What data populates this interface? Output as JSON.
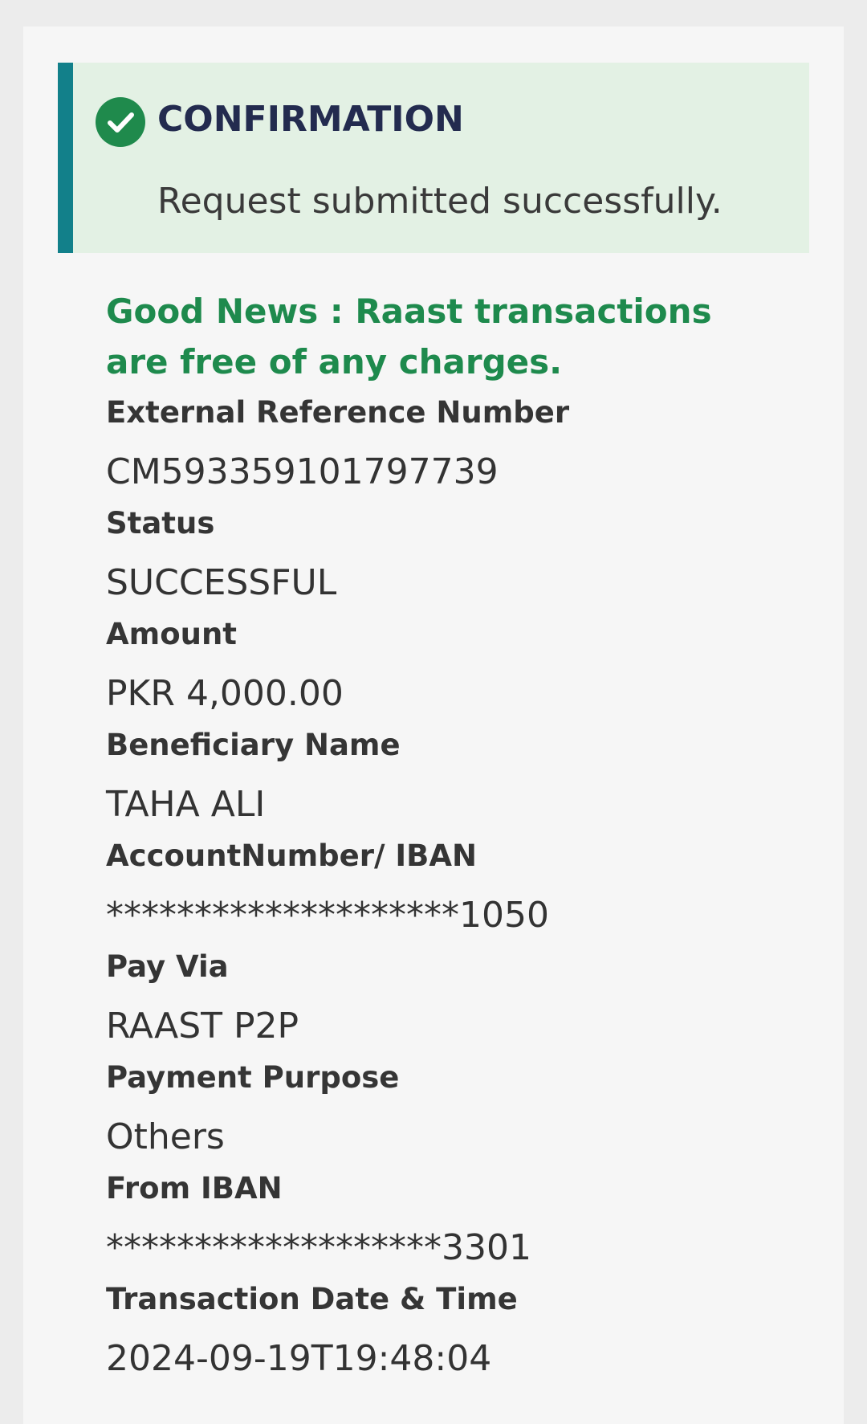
{
  "confirmation": {
    "title": "CONFIRMATION",
    "message": "Request submitted successfully.",
    "icon": "check-circle-icon",
    "accent_color": "#12808a",
    "success_color": "#1f8a4c"
  },
  "notice": {
    "text": "Good News : Raast transactions are free of any charges."
  },
  "fields": [
    {
      "label": "External Reference Number",
      "value": "CM593359101797739"
    },
    {
      "label": "Status",
      "value": "SUCCESSFUL"
    },
    {
      "label": "Amount",
      "value": "PKR 4,000.00"
    },
    {
      "label": "Beneficiary Name",
      "value": "TAHA ALI"
    },
    {
      "label": "AccountNumber/ IBAN",
      "value": "********************1050"
    },
    {
      "label": "Pay Via",
      "value": "RAAST P2P"
    },
    {
      "label": "Payment Purpose",
      "value": "Others"
    },
    {
      "label": "From IBAN",
      "value": "*******************3301"
    },
    {
      "label": "Transaction Date & Time",
      "value": "2024-09-19T19:48:04"
    }
  ]
}
